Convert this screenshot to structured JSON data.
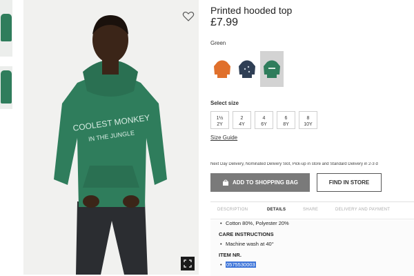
{
  "product": {
    "title": "Printed hooded top",
    "price": "£7.99",
    "color_name": "Green"
  },
  "swatches": [
    {
      "name": "orange",
      "color": "#e0702c",
      "selected": false
    },
    {
      "name": "navy",
      "color": "#2f3f55",
      "selected": false
    },
    {
      "name": "green",
      "color": "#2f7d5c",
      "selected": true
    }
  ],
  "image": {
    "hoodie_text_line1": "COOLEST MONKEY",
    "hoodie_text_line2": "IN THE JUNGLE",
    "hoodie_color": "#2f7d5c"
  },
  "sizes": {
    "label": "Select size",
    "options": [
      {
        "top": "1½",
        "bottom": "2Y"
      },
      {
        "top": "2",
        "bottom": "4Y"
      },
      {
        "top": "4",
        "bottom": "6Y"
      },
      {
        "top": "6",
        "bottom": "8Y"
      },
      {
        "top": "8",
        "bottom": "10Y"
      }
    ],
    "guide_label": "Size Guide"
  },
  "delivery_text": "Next Day Delivery, Nominated Delivery Slot, Pick-up in store and Standard Delivery in 2-3 d",
  "actions": {
    "add_to_bag": "ADD TO SHOPPING BAG",
    "find_in_store": "FIND IN STORE"
  },
  "tabs": {
    "items": [
      "DESCRIPTION",
      "DETAILS",
      "SHARE",
      "DELIVERY AND PAYMENT"
    ],
    "active": "DETAILS"
  },
  "details": {
    "composition": "Cotton 80%, Polyester 20%",
    "care_heading": "CARE INSTRUCTIONS",
    "care_item": "Machine wash at 40°",
    "item_nr_heading": "ITEM NR.",
    "item_nr": "0575530003"
  },
  "colors": {
    "add_button_bg": "#7a7a7a",
    "selection_highlight": "#3b73d8"
  }
}
